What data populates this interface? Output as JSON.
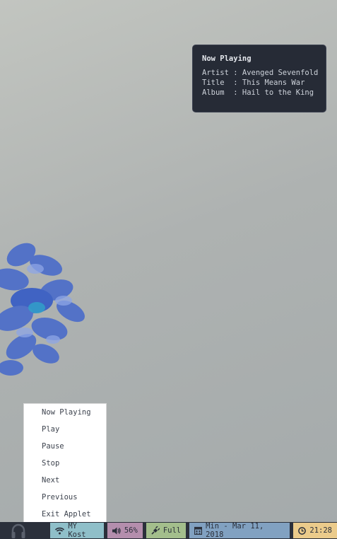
{
  "notification": {
    "title": "Now Playing",
    "lines": [
      "Artist : Avenged Sevenfold",
      "Title  : This Means War",
      "Album  : Hail to the King"
    ]
  },
  "menu": {
    "items": [
      "Now Playing",
      "Play",
      "Pause",
      "Stop",
      "Next",
      "Previous",
      "Exit Applet"
    ]
  },
  "statusbar": {
    "tray_icon": "headphones-icon",
    "wifi": {
      "icon": "wifi-icon",
      "label": "MY Kost",
      "color": "#8fbfc9"
    },
    "volume": {
      "icon": "volume-icon",
      "label": "56%",
      "color": "#b48ead"
    },
    "battery": {
      "icon": "plug-icon",
      "label": "Full",
      "color": "#a3be8c"
    },
    "date": {
      "icon": "calendar-icon",
      "label": "Min - Mar 11, 2018",
      "color": "#81a1c1"
    },
    "clock": {
      "icon": "clock-icon",
      "label": "21:28",
      "color": "#ebcb8b"
    },
    "background": "#2b303b"
  }
}
